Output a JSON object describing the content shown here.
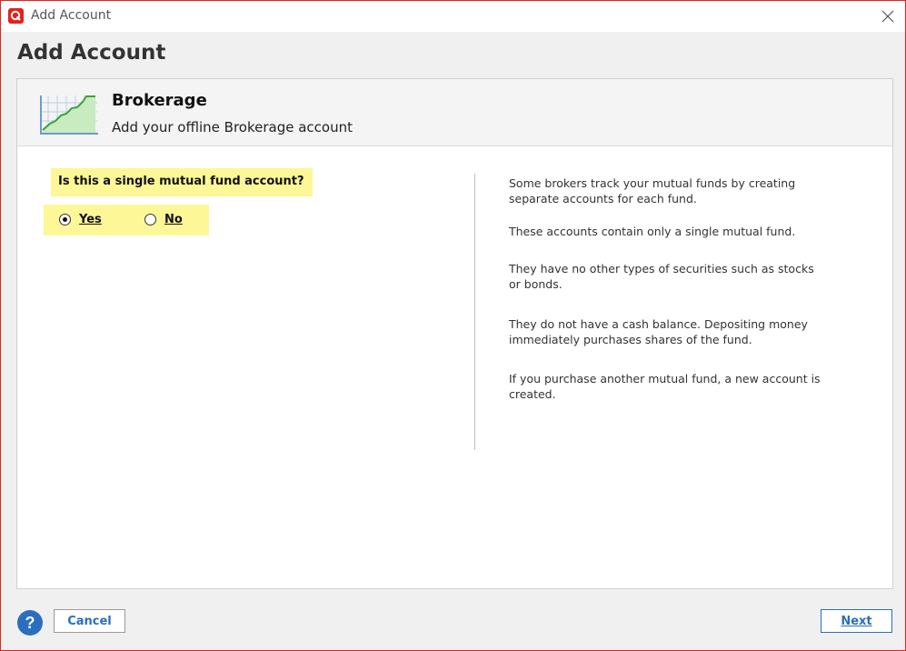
{
  "window": {
    "title": "Add Account",
    "app_icon": "quicken-logo-icon",
    "close_icon": "close-icon"
  },
  "heading": "Add Account",
  "account_type": {
    "name": "Brokerage",
    "description": "Add your offline Brokerage account",
    "icon": "chart-icon"
  },
  "question": {
    "text": "Is this a single mutual fund account?",
    "options": [
      {
        "label": "Yes",
        "selected": true
      },
      {
        "label": "No",
        "selected": false
      }
    ]
  },
  "info_paragraphs": [
    "Some brokers track your mutual funds by creating separate accounts for each fund.",
    "These accounts contain only a single mutual fund.",
    "They have no other types of securities such as stocks or bonds.",
    "They do not have a cash balance. Depositing money immediately purchases shares of the fund.",
    "If you purchase another mutual fund, a new account is created."
  ],
  "footer": {
    "help_label": "?",
    "cancel_label": "Cancel",
    "next_label": "Next"
  },
  "colors": {
    "brand": "#e2231a",
    "accent": "#2a6ebd",
    "highlight": "#fdf797"
  }
}
